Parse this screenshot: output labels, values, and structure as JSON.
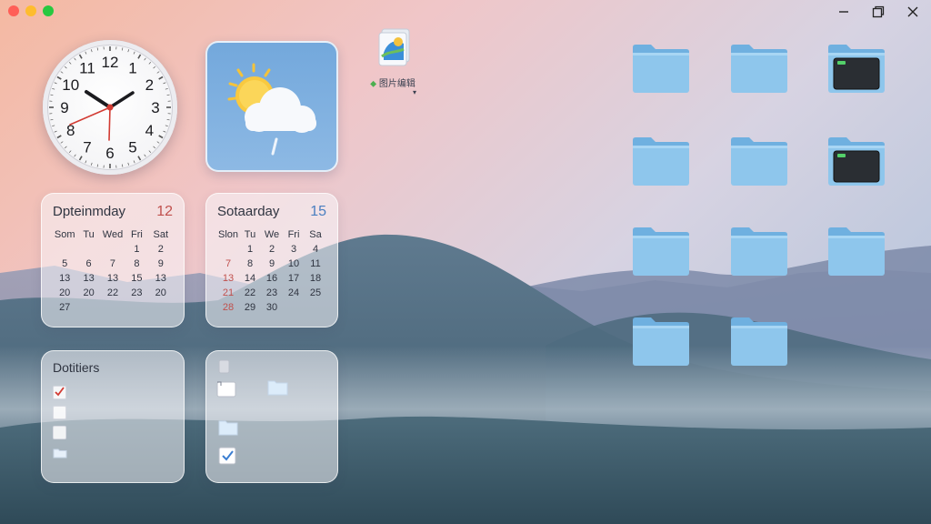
{
  "clock": {
    "numerals": [
      "12",
      "1",
      "2",
      "3",
      "4",
      "5",
      "6",
      "7",
      "8",
      "9",
      "10",
      "11"
    ]
  },
  "desktop_file": {
    "label": "图片编辑",
    "caret": "▾"
  },
  "calendar_left": {
    "title": "Dpteinmday",
    "date": "12",
    "weekdays": [
      "Som",
      "Tu",
      "Wed",
      "Fri",
      "Sat"
    ],
    "rows": [
      [
        "",
        "",
        "",
        "1",
        "2"
      ],
      [
        "5",
        "6",
        "7",
        "8",
        "9"
      ],
      [
        "13",
        "13",
        "13",
        "15",
        "13"
      ],
      [
        "20",
        "20",
        "22",
        "23",
        "20"
      ],
      [
        "27",
        "",
        "",
        "",
        ""
      ]
    ]
  },
  "calendar_right": {
    "title": "Sotaarday",
    "date": "15",
    "weekdays": [
      "Slon",
      "Tu",
      "We",
      "Fri",
      "Sa"
    ],
    "rows": [
      [
        "",
        "1",
        "2",
        "3",
        "4"
      ],
      [
        "7",
        "8",
        "9",
        "10",
        "11"
      ],
      [
        "13",
        "14",
        "16",
        "17",
        "18"
      ],
      [
        "21",
        "22",
        "23",
        "24",
        "25"
      ],
      [
        "28",
        "29",
        "30",
        "",
        ""
      ]
    ]
  },
  "todo": {
    "title": "Dotitiers"
  },
  "colors": {
    "accent_red": "#c0504d",
    "accent_blue": "#4a7fc0",
    "folder_blue": "#8ec6ec",
    "traffic_red": "#ff5f57",
    "traffic_yellow": "#febc2e",
    "traffic_green": "#28c840"
  },
  "folders": [
    {
      "name": "folder",
      "type": "folder"
    },
    {
      "name": "folder",
      "type": "folder"
    },
    {
      "name": "terminal",
      "type": "terminal"
    },
    {
      "name": "folder",
      "type": "folder"
    },
    {
      "name": "folder",
      "type": "folder"
    },
    {
      "name": "terminal",
      "type": "terminal"
    },
    {
      "name": "folder",
      "type": "folder"
    },
    {
      "name": "folder",
      "type": "folder"
    },
    {
      "name": "folder",
      "type": "folder"
    },
    {
      "name": "folder",
      "type": "folder"
    },
    {
      "name": "folder",
      "type": "folder"
    }
  ]
}
